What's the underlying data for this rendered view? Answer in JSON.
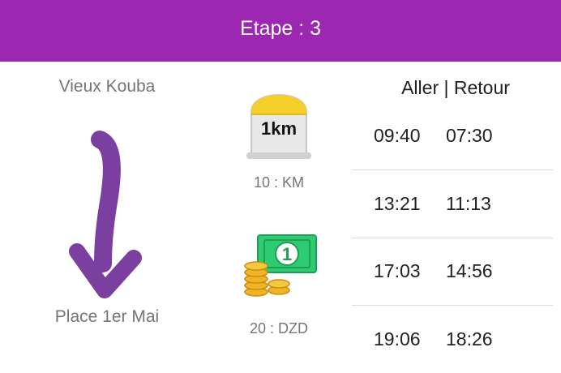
{
  "header": {
    "title": "Etape : 3"
  },
  "route": {
    "from": "Vieux Kouba",
    "to": "Place 1er Mai",
    "arrow_icon": "down-arrow-icon"
  },
  "distance": {
    "icon_text": "1km",
    "label": "10 : KM",
    "icon": "milestone-icon"
  },
  "price": {
    "label": "20 : DZD",
    "icon": "money-icon",
    "icon_digit": "1"
  },
  "schedule": {
    "header": "Aller | Retour",
    "rows": [
      {
        "aller": "09:40",
        "retour": "07:30"
      },
      {
        "aller": "13:21",
        "retour": "11:13"
      },
      {
        "aller": "17:03",
        "retour": "14:56"
      },
      {
        "aller": "19:06",
        "retour": "18:26"
      }
    ]
  },
  "colors": {
    "header_bg": "#9C27B0",
    "arrow": "#7B3FA0"
  }
}
